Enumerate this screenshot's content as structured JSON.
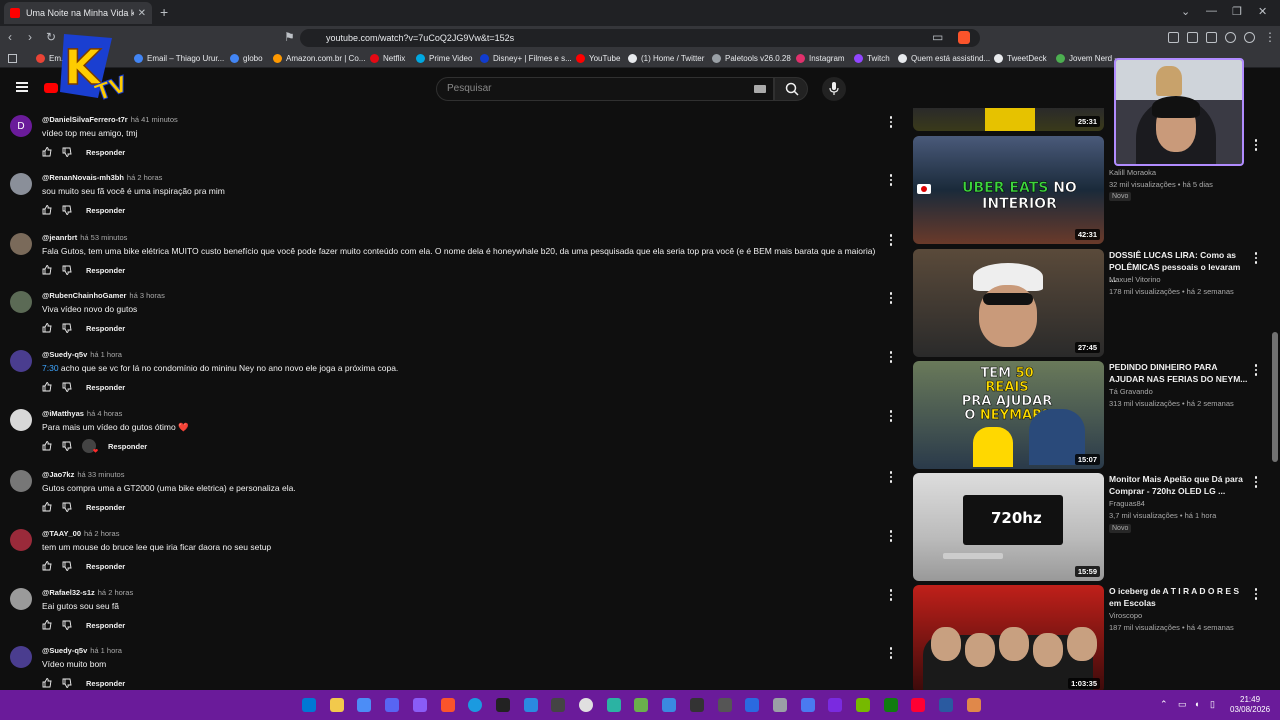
{
  "browser": {
    "tab_title": "Uma Noite na Minha Vida kkkkk",
    "url": "youtube.com/watch?v=7uCoQ2JG9Vw&t=152s",
    "bookmarks": [
      "Em...",
      "Email – Thiago Urur...",
      "globo",
      "Amazon.com.br | Co...",
      "Netflix",
      "Prime Video",
      "Disney+ | Filmes e s...",
      "YouTube",
      "(1) Home / Twitter",
      "Paletools v26.0.28",
      "Instagram",
      "Twitch",
      "Quem está assistind...",
      "TweetDeck",
      "Jovem Nerd - ..."
    ]
  },
  "youtube": {
    "search_placeholder": "Pesquisar",
    "logo_text": "KTV"
  },
  "comments": [
    {
      "handle": "@DanielSilvaFerrero-t7r",
      "time": "há 41 minutos",
      "text": "vídeo top meu amigo, tmj",
      "avatar_letter": "D",
      "avatar_color": "#6a1b9a"
    },
    {
      "handle": "@RenanNovais-mh3bh",
      "time": "há 2 horas",
      "text": "sou muito seu fã você é uma inspiração pra mim",
      "avatar_letter": "",
      "avatar_color": "#8a8f99"
    },
    {
      "handle": "@jeanrbrt",
      "time": "há 53 minutos",
      "text": "Fala Gutos, tem uma bike elétrica MUITO custo benefício que você pode fazer muito conteúdo com ela. O nome dela é honeywhale b20, da uma pesquisada que ela seria top pra você (e é BEM mais barata que a maioria)",
      "avatar_letter": "",
      "avatar_color": "#7a6a5a"
    },
    {
      "handle": "@RubenChainhoGamer",
      "time": "há 3 horas",
      "text": "Viva vídeo novo do gutos",
      "avatar_letter": "",
      "avatar_color": "#5b6a55"
    },
    {
      "handle": "@Suedy-q5v",
      "time": "há 1 hora",
      "timestamp": "7:30",
      "text": " acho que se vc for lá no condomínio do mininu Ney no ano novo ele joga a próxima copa.",
      "avatar_letter": "",
      "avatar_color": "#4a3d8f"
    },
    {
      "handle": "@iMatthyas",
      "time": "há 4 horas",
      "text": "Para mais um vídeo do gutos ótimo ❤️",
      "avatar_letter": "",
      "avatar_color": "#d8d8d8"
    },
    {
      "handle": "@Jao7kz",
      "time": "há 33 minutos",
      "text": "Gutos compra uma a GT2000 (uma bike eletrica) e personaliza ela.",
      "avatar_letter": "",
      "avatar_color": "#777"
    },
    {
      "handle": "@TAAY_00",
      "time": "há 2 horas",
      "text": "tem um mouse do bruce lee que iria ficar daora no seu setup",
      "avatar_letter": "",
      "avatar_color": "#9a2a3a"
    },
    {
      "handle": "@Rafael32-s1z",
      "time": "há 2 horas",
      "text": "Eai gutos sou seu fã",
      "avatar_letter": "",
      "avatar_color": "#9a9a9a"
    },
    {
      "handle": "@Suedy-q5v",
      "time": "há 1 hora",
      "text": "Vídeo muito bom",
      "avatar_letter": "",
      "avatar_color": "#4a3d8f"
    }
  ],
  "reply_label": "Responder",
  "videos": [
    {
      "title": "",
      "channel": "",
      "stats": "",
      "duration": "25:31",
      "badge": ""
    },
    {
      "title": "",
      "channel": "Kalill Moraoka",
      "stats": "32 mil visualizações • há 5 dias",
      "duration": "42:31",
      "badge": "Novo",
      "thumb_text": "UBER EATS NO INTERIOR"
    },
    {
      "title": "DOSSIÊ LUCAS LIRA: Como as POLÊMICAS pessoais o levaram ...",
      "channel": "Maxuel Vitorino",
      "stats": "178 mil visualizações • há 2 semanas",
      "duration": "27:45",
      "badge": ""
    },
    {
      "title": "PEDINDO DINHEIRO PARA AJUDAR NAS FERIAS DO NEYM...",
      "channel": "Tá Gravando",
      "stats": "313 mil visualizações • há 2 semanas",
      "duration": "15:07",
      "badge": "",
      "thumb_text": "TEM 50 REAIS PRA AJUDAR O NEYMAR?"
    },
    {
      "title": "Monitor Mais Apelão que Dá para Comprar - 720hz OLED LG ...",
      "channel": "Fraguas84",
      "stats": "3,7 mil visualizações • há 1 hora",
      "duration": "15:59",
      "badge": "Novo",
      "thumb_text": "720hz"
    },
    {
      "title": "O iceberg de A T I R A D O R E S em Escolas",
      "channel": "Viroscopo",
      "stats": "187 mil visualizações • há 4 semanas",
      "duration": "1:03:35",
      "badge": ""
    }
  ],
  "clock": {
    "time": "21:49",
    "date": "03/08/2026"
  }
}
